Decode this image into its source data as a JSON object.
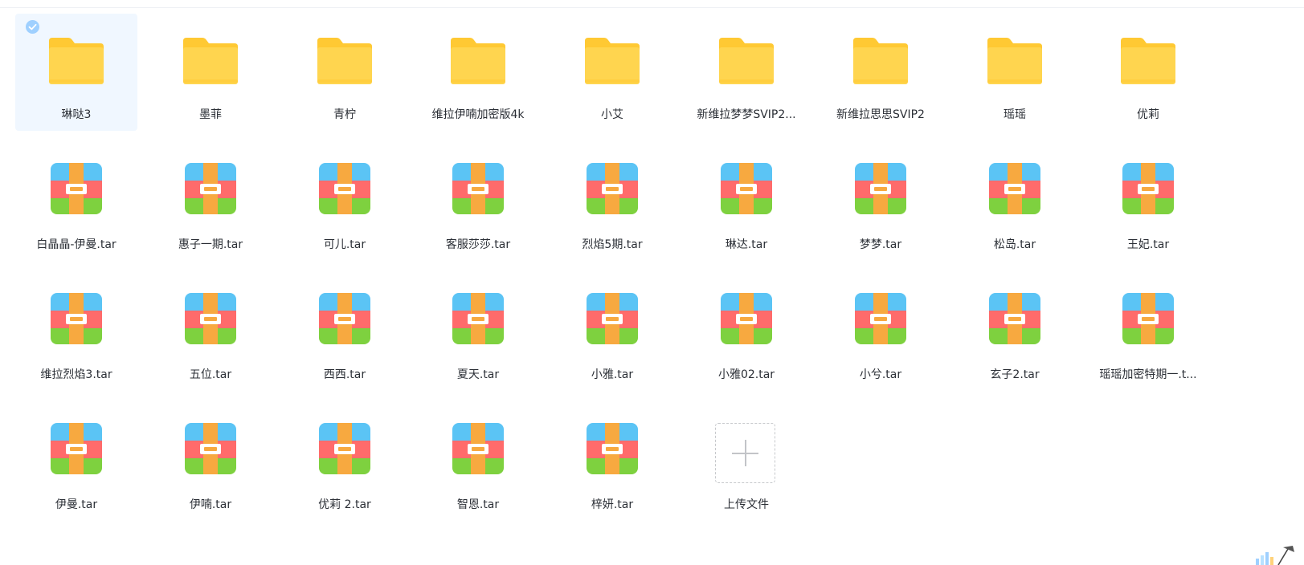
{
  "colors": {
    "folder_back": "#FFC933",
    "folder_front": "#FFD54F",
    "archive_top": "#5BC4F5",
    "archive_middle": "#FF6B6B",
    "archive_bottom": "#7ED13F",
    "archive_strap": "#F7A940",
    "selected_bg": "#F0F7FF",
    "check_bg": "#9FD0FF"
  },
  "files": {
    "folders": [
      {
        "name": "琳哒3",
        "icon": "folder-icon",
        "selected": true
      },
      {
        "name": "墨菲",
        "icon": "folder-icon"
      },
      {
        "name": "青柠",
        "icon": "folder-icon"
      },
      {
        "name": "维拉伊喃加密版4k",
        "icon": "folder-icon"
      },
      {
        "name": "小艾",
        "icon": "folder-icon"
      },
      {
        "name": "新维拉梦梦SVIP2...",
        "icon": "folder-icon"
      },
      {
        "name": "新维拉思思SVIP2",
        "icon": "folder-icon"
      },
      {
        "name": "瑶瑶",
        "icon": "folder-icon"
      },
      {
        "name": "优莉",
        "icon": "folder-icon"
      }
    ],
    "archives": [
      {
        "name": "白晶晶-伊曼.tar",
        "icon": "archive-icon"
      },
      {
        "name": "惠子一期.tar",
        "icon": "archive-icon"
      },
      {
        "name": "可儿.tar",
        "icon": "archive-icon"
      },
      {
        "name": "客服莎莎.tar",
        "icon": "archive-icon"
      },
      {
        "name": "烈焰5期.tar",
        "icon": "archive-icon"
      },
      {
        "name": "琳达.tar",
        "icon": "archive-icon"
      },
      {
        "name": "梦梦.tar",
        "icon": "archive-icon"
      },
      {
        "name": "松岛.tar",
        "icon": "archive-icon"
      },
      {
        "name": "王妃.tar",
        "icon": "archive-icon"
      },
      {
        "name": "维拉烈焰3.tar",
        "icon": "archive-icon"
      },
      {
        "name": "五位.tar",
        "icon": "archive-icon"
      },
      {
        "name": "西西.tar",
        "icon": "archive-icon"
      },
      {
        "name": "夏天.tar",
        "icon": "archive-icon"
      },
      {
        "name": "小雅.tar",
        "icon": "archive-icon"
      },
      {
        "name": "小雅02.tar",
        "icon": "archive-icon"
      },
      {
        "name": "小兮.tar",
        "icon": "archive-icon"
      },
      {
        "name": "玄子2.tar",
        "icon": "archive-icon"
      },
      {
        "name": "瑶瑶加密特期一.t...",
        "icon": "archive-icon"
      },
      {
        "name": "伊曼.tar",
        "icon": "archive-icon"
      },
      {
        "name": "伊喃.tar",
        "icon": "archive-icon"
      },
      {
        "name": "优莉 2.tar",
        "icon": "archive-icon"
      },
      {
        "name": "智恩.tar",
        "icon": "archive-icon"
      },
      {
        "name": "梓妍.tar",
        "icon": "archive-icon"
      }
    ]
  },
  "upload": {
    "label": "上传文件",
    "icon": "plus-icon"
  }
}
